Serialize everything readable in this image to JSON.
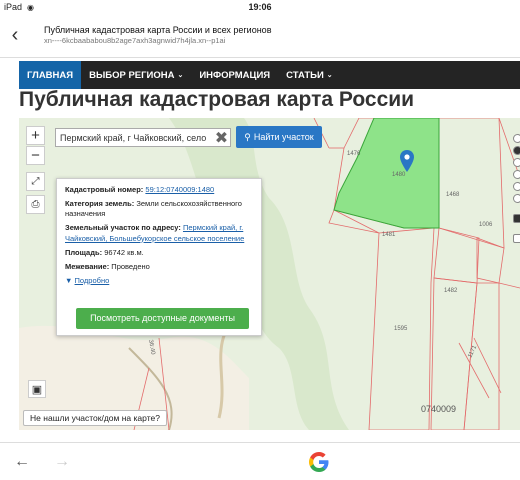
{
  "status_bar": {
    "device": "iPad",
    "time": "19:06"
  },
  "browser": {
    "page_title": "Публичная кадастровая карта России и всех регионов",
    "url": "xn----6kcbaababou8b2age7axh3agnwid7h4jla.xn--p1ai"
  },
  "nav": {
    "items": [
      {
        "label": "ГЛАВНАЯ",
        "dropdown": false
      },
      {
        "label": "ВЫБОР РЕГИОНА",
        "dropdown": true
      },
      {
        "label": "ИНФОРМАЦИЯ",
        "dropdown": false
      },
      {
        "label": "СТАТЬИ",
        "dropdown": true
      }
    ]
  },
  "heading": "Публичная кадастровая карта России",
  "map": {
    "zoom_in": "+",
    "zoom_out": "−",
    "search": {
      "value": "Пермский край, г Чайковский, село"
    },
    "find_button": "Найти участок",
    "not_found_button": "Не нашли участок/дом на карте?",
    "selected_color": "#7ee07a",
    "parcel_labels": [
      "1476",
      "1480",
      "1468",
      "1006",
      "1481",
      "1482",
      "1595",
      "1171",
      "36:40"
    ],
    "cadastral_block": "0740009",
    "info": {
      "cadnum_label": "Кадастровый номер:",
      "cadnum_value": "59:12:0740009:1480",
      "category_label": "Категория земель:",
      "category_value": "Земли сельскохозяйственного назначения",
      "address_label": "Земельный участок по адресу:",
      "address_value": "Пермский край, г. Чайковский, Большебукорское сельское поселение",
      "area_label": "Площадь:",
      "area_value": "96742 кв.м.",
      "survey_label": "Межевание:",
      "survey_value": "Проведено",
      "more_link": "Подробно",
      "docs_button": "Посмотреть доступные документы"
    }
  }
}
